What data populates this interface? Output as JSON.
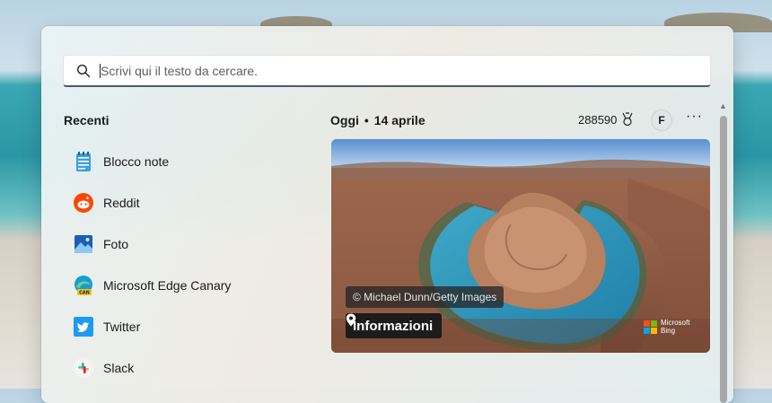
{
  "search": {
    "placeholder": "Scrivi qui il testo da cercare."
  },
  "recent": {
    "title": "Recenti",
    "items": [
      {
        "label": "Blocco note",
        "icon": "notepad-icon"
      },
      {
        "label": "Reddit",
        "icon": "reddit-icon"
      },
      {
        "label": "Foto",
        "icon": "photos-icon"
      },
      {
        "label": "Microsoft Edge Canary",
        "icon": "edge-canary-icon"
      },
      {
        "label": "Twitter",
        "icon": "twitter-icon"
      },
      {
        "label": "Slack",
        "icon": "slack-icon"
      }
    ]
  },
  "today": {
    "label": "Oggi",
    "separator": "•",
    "date": "14 aprile"
  },
  "rewards": {
    "points": "288590",
    "icon": "rewards-medal-icon"
  },
  "profile": {
    "initial": "F"
  },
  "more": {
    "label": "···"
  },
  "hero": {
    "credit": "© Michael Dunn/Getty Images",
    "info_label": "Informazioni",
    "brand_line1": "Microsoft",
    "brand_line2": "Bing"
  },
  "colors": {
    "accent_underline": "#4b5a66",
    "ms_red": "#f25022",
    "ms_green": "#7fba00",
    "ms_blue": "#00a4ef",
    "ms_yellow": "#ffb900"
  }
}
